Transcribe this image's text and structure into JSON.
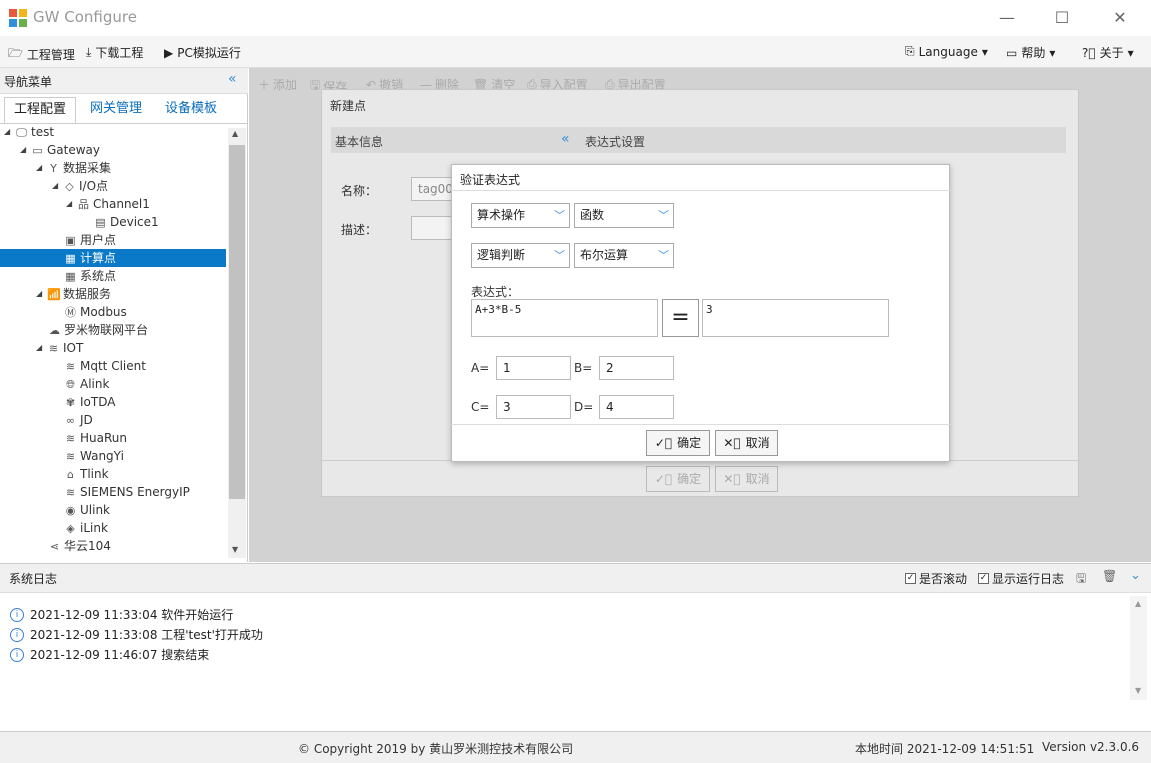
{
  "window": {
    "title": "GW Configure"
  },
  "menu": {
    "project": "工程管理",
    "download": "下载工程",
    "simulate": "PC模拟运行",
    "language": "Language",
    "help": "帮助",
    "about": "关于"
  },
  "nav": {
    "header": "导航菜单",
    "tabs": [
      "工程配置",
      "网关管理",
      "设备模板"
    ],
    "tree": [
      {
        "label": "test"
      },
      {
        "label": "Gateway"
      },
      {
        "label": "数据采集"
      },
      {
        "label": "I/O点"
      },
      {
        "label": "Channel1"
      },
      {
        "label": "Device1"
      },
      {
        "label": "用户点"
      },
      {
        "label": "计算点"
      },
      {
        "label": "系统点"
      },
      {
        "label": "数据服务"
      },
      {
        "label": "Modbus"
      },
      {
        "label": "罗米物联网平台"
      },
      {
        "label": "IOT"
      },
      {
        "label": "Mqtt Client"
      },
      {
        "label": "Alink"
      },
      {
        "label": "IoTDA"
      },
      {
        "label": "JD"
      },
      {
        "label": "HuaRun"
      },
      {
        "label": "WangYi"
      },
      {
        "label": "Tlink"
      },
      {
        "label": "SIEMENS EnergyIP"
      },
      {
        "label": "Ulink"
      },
      {
        "label": "iLink"
      },
      {
        "label": "华云104"
      }
    ]
  },
  "toolbar": {
    "add": "添加",
    "save": "保存",
    "undo": "撤销",
    "delete": "删除",
    "clear": "清空",
    "import": "导入配置",
    "export": "导出配置"
  },
  "new_point": {
    "title": "新建点",
    "basic": "基本信息",
    "expr_settings": "表达式设置",
    "name_label": "名称：",
    "name_value": "tag000",
    "desc_label": "描述：",
    "ok": "确定",
    "cancel": "取消"
  },
  "verify": {
    "title": "验证表达式",
    "sel1": "算术操作",
    "sel2": "函数",
    "sel3": "逻辑判断",
    "sel4": "布尔运算",
    "expr_label": "表达式：",
    "expr": "A+3*B-5",
    "result": "3",
    "vars": [
      {
        "name": "A=",
        "value": "1"
      },
      {
        "name": "B=",
        "value": "2"
      },
      {
        "name": "C=",
        "value": "3"
      },
      {
        "name": "D=",
        "value": "4"
      }
    ],
    "ok": "确定",
    "cancel": "取消"
  },
  "log": {
    "title": "系统日志",
    "scroll": "是否滚动",
    "show_run": "显示运行日志",
    "lines": [
      "2021-12-09 11:33:04 软件开始运行",
      "2021-12-09 11:33:08 工程'test'打开成功",
      "2021-12-09 11:46:07 搜索结束"
    ]
  },
  "footer": {
    "copyright": "© Copyright 2019 by 黄山罗米测控技术有限公司",
    "time": "本地时间 2021-12-09 14:51:51",
    "version": "Version v2.3.0.6"
  }
}
